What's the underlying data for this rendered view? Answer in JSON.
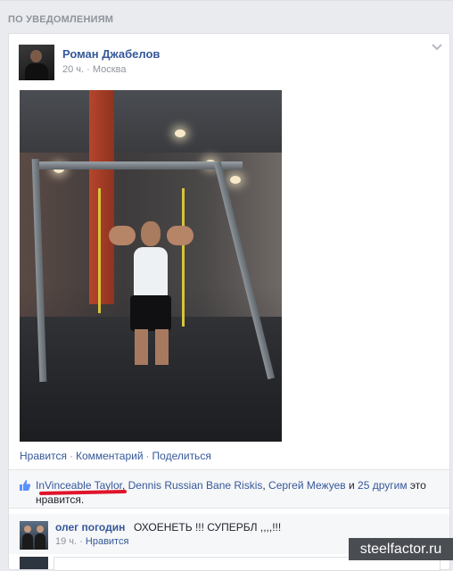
{
  "section_header": "ПО УВЕДОМЛЕНИЯМ",
  "post": {
    "author": "Роман Джабелов",
    "time": "20 ч.",
    "location_sep": "·",
    "location": "Москва",
    "actions": {
      "like": "Нравится",
      "comment": "Комментарий",
      "share": "Поделиться",
      "sep": "·"
    },
    "likes": {
      "name1": "InVinceable Taylor",
      "sep1": ", ",
      "name2": "Dennis Russian Bane Riskis",
      "sep2": ", ",
      "name3": "Сергей Межуев",
      "and": " и ",
      "others": "25 другим",
      "suffix": " это нравится."
    }
  },
  "comment": {
    "author": "олег погодин",
    "text": "ОХОЕНЕТЬ !!! СУПЕРБЛ ,,,,!!!",
    "time": "19 ч.",
    "sep": "·",
    "like": "Нравится"
  },
  "watermark": "steelfactor.ru",
  "icons": {
    "like": "thumbs-up-icon",
    "options": "chevron-down-icon"
  },
  "colors": {
    "link": "#365899",
    "accent_underline": "#e0142b",
    "background": "#e9ebee"
  }
}
